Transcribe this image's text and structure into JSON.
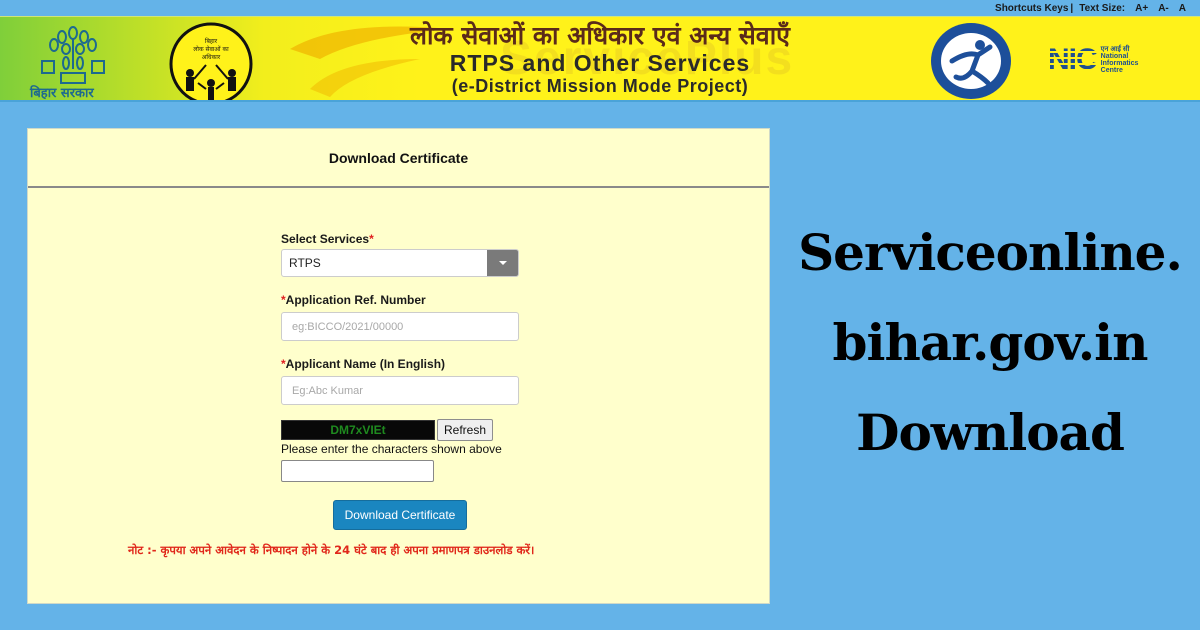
{
  "topbar": {
    "shortcuts_label": "Shortcuts Keys",
    "separator": "|",
    "text_size_label": "Text Size:",
    "text_size_buttons": [
      "A+",
      "A-",
      "A"
    ]
  },
  "banner": {
    "emblem_caption": "बिहार सरकार",
    "rtps_logo_text": "बिहार लोक सेवाओं का अधिकार अधिनियम",
    "title_hindi": "लोक सेवाओं का अधिकार एवं अन्य सेवाएँ",
    "title_english": "RTPS and Other Services",
    "subtitle": "(e-District Mission Mode Project)",
    "watermark": "ServicePlus",
    "nic": {
      "mark": "NIC",
      "hindi": "एन आई सी",
      "line1": "National",
      "line2": "Informatics",
      "line3": "Centre"
    },
    "colors": {
      "yellow": "#fff21a",
      "green": "#7fcf3a"
    }
  },
  "panel": {
    "header_title": "Download Certificate",
    "background": "#ffffcc",
    "form": {
      "service_label": "Select Services",
      "service_value": "RTPS",
      "ref_label": "Application Ref. Number",
      "ref_placeholder": "eg:BICCO/2021/00000",
      "ref_value": "",
      "name_label": "Applicant Name (In English)",
      "name_placeholder": "Eg:Abc Kumar",
      "name_value": "",
      "required_mark": "*",
      "captcha_text": "DM7xVIEt",
      "refresh_label": "Refresh",
      "captcha_hint": "Please enter the characters shown above",
      "captcha_value": "",
      "submit_label": "Download Certificate"
    },
    "note": "नोट :- कृपया अपने आवेदन के निष्पादन होने के 24 घंटे बाद ही अपना प्रमाणपत्र डाउनलोड करें।"
  },
  "side_title": {
    "line1": "Serviceonline.",
    "line2": "bihar.gov.in",
    "line3": "Download"
  },
  "colors": {
    "page_background": "#64b3e8",
    "button_primary": "#1a86c0",
    "note_red": "#e0271a",
    "required_red": "#e02020"
  }
}
